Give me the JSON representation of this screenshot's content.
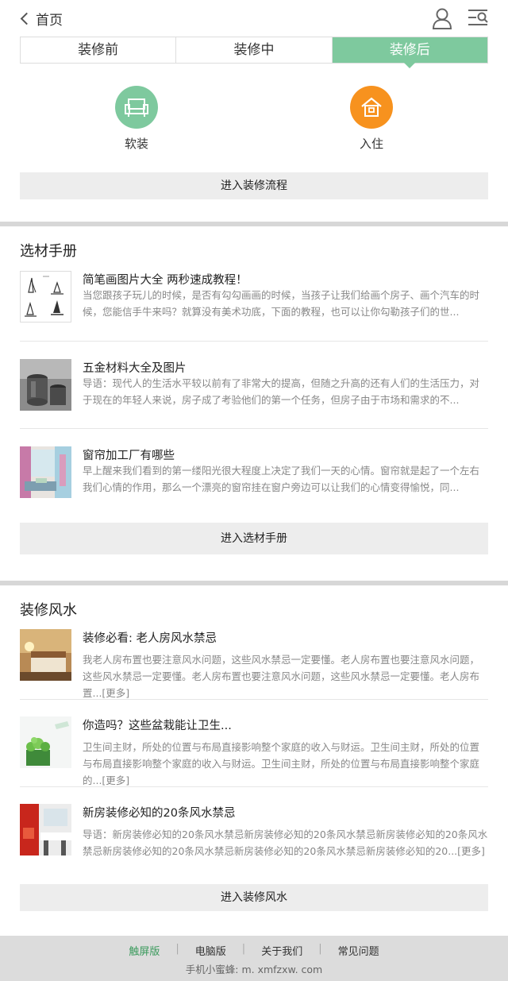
{
  "header": {
    "back_label": "首页",
    "user_icon": "user-icon",
    "menu_icon": "search-list-icon"
  },
  "tabs": [
    {
      "label": "装修前",
      "active": false
    },
    {
      "label": "装修中",
      "active": false
    },
    {
      "label": "装修后",
      "active": true
    }
  ],
  "stages": [
    {
      "label": "软装",
      "icon": "sofa-icon",
      "color": "#7ec99e"
    },
    {
      "label": "入住",
      "icon": "house-icon",
      "color": "#f7921e"
    }
  ],
  "process_button": "进入装修流程",
  "materials": {
    "title": "选材手册",
    "items": [
      {
        "title": "简笔画图片大全 两秒速成教程！",
        "desc": "当您跟孩子玩儿的时候，是否有勾勾画画的时候，当孩子让我们给画个房子、画个汽车的时候，您能信手牛来吗？就算没有美术功底，下面的教程，也可以让你勾勒孩子们的世..."
      },
      {
        "title": "五金材料大全及图片",
        "desc": "导语：现代人的生活水平较以前有了非常大的提高，但随之升高的还有人们的生活压力，对于现在的年轻人来说，房子成了考验他们的第一个任务，但房子由于市场和需求的不..."
      },
      {
        "title": "窗帘加工厂有哪些",
        "desc": "早上醒来我们看到的第一缕阳光很大程度上决定了我们一天的心情。窗帘就是起了一个左右我们心情的作用，那么一个漂亮的窗帘挂在窗户旁边可以让我们的心情变得愉悦，同..."
      }
    ],
    "button": "进入选材手册"
  },
  "fengshui": {
    "title": "装修风水",
    "items": [
      {
        "title": "装修必看: 老人房风水禁忌",
        "desc": "我老人房布置也要注意风水问题，这些风水禁忌一定要懂。老人房布置也要注意风水问题，这些风水禁忌一定要懂。老人房布置也要注意风水问题，这些风水禁忌一定要懂。老人房布置...",
        "more": "[更多]"
      },
      {
        "title": "你造吗？这些盆栽能让卫生...",
        "desc": "卫生间主财，所处的位置与布局直接影响整个家庭的收入与财运。卫生间主财，所处的位置与布局直接影响整个家庭的收入与财运。卫生间主财，所处的位置与布局直接影响整个家庭的...",
        "more": "[更多]"
      },
      {
        "title": "新房装修必知的20条风水禁忌",
        "desc": "导语：新房装修必知的20条风水禁忌新房装修必知的20条风水禁忌新房装修必知的20条风水禁忌新房装修必知的20条风水禁忌新房装修必知的20条风水禁忌新房装修必知的20...",
        "more": "[更多]"
      }
    ],
    "button": "进入装修风水"
  },
  "footer": {
    "links": [
      {
        "label": "触屏版",
        "active": true
      },
      {
        "label": "电脑版",
        "active": false
      },
      {
        "label": "关于我们",
        "active": false
      },
      {
        "label": "常见问题",
        "active": false
      }
    ],
    "contact_label": "手机小蜜蜂:",
    "contact_url": "m. xmfzxw. com"
  },
  "colors": {
    "accent_green": "#7ec99e",
    "accent_orange": "#f7921e",
    "footer_active": "#3a9a5c"
  }
}
